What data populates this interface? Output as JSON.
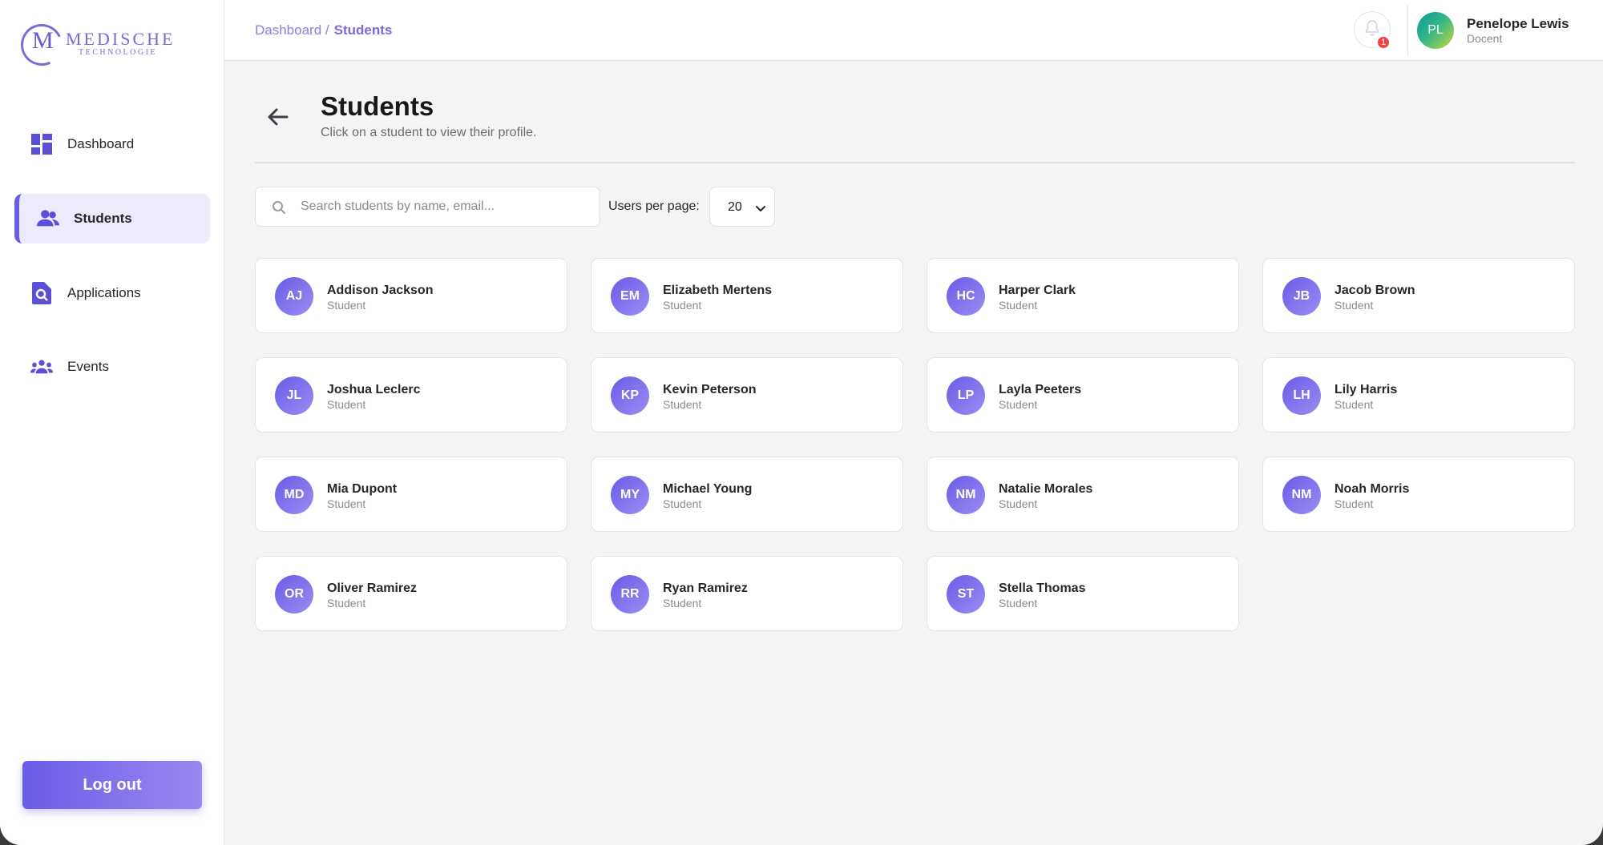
{
  "brand": {
    "mark": "M",
    "name": "MEDISCHE",
    "subtitle": "TECHNOLOGIE",
    "accent_color": "#6b5ce7"
  },
  "sidebar": {
    "items": [
      {
        "label": "Dashboard",
        "icon": "dashboard-icon",
        "active": false
      },
      {
        "label": "Students",
        "icon": "users-icon",
        "active": true
      },
      {
        "label": "Applications",
        "icon": "document-search-icon",
        "active": false
      },
      {
        "label": "Events",
        "icon": "group-icon",
        "active": false
      }
    ],
    "logout_label": "Log out"
  },
  "header": {
    "breadcrumb": {
      "root": "Dashboard /",
      "current": "Students"
    },
    "notifications": {
      "icon": "bell-icon",
      "count": "1"
    },
    "user": {
      "initials": "PL",
      "name": "Penelope Lewis",
      "role": "Docent"
    }
  },
  "main": {
    "title": "Students",
    "subtitle": "Click on a student to view their profile.",
    "search": {
      "placeholder": "Search students by name, email...",
      "value": ""
    },
    "per_page": {
      "label": "Users per page:",
      "value": "20"
    },
    "students": [
      {
        "initials": "AJ",
        "name": "Addison Jackson",
        "role": "Student"
      },
      {
        "initials": "EM",
        "name": "Elizabeth Mertens",
        "role": "Student"
      },
      {
        "initials": "HC",
        "name": "Harper Clark",
        "role": "Student"
      },
      {
        "initials": "JB",
        "name": "Jacob Brown",
        "role": "Student"
      },
      {
        "initials": "JL",
        "name": "Joshua Leclerc",
        "role": "Student"
      },
      {
        "initials": "KP",
        "name": "Kevin Peterson",
        "role": "Student"
      },
      {
        "initials": "LP",
        "name": "Layla Peeters",
        "role": "Student"
      },
      {
        "initials": "LH",
        "name": "Lily Harris",
        "role": "Student"
      },
      {
        "initials": "MD",
        "name": "Mia Dupont",
        "role": "Student"
      },
      {
        "initials": "MY",
        "name": "Michael Young",
        "role": "Student"
      },
      {
        "initials": "NM",
        "name": "Natalie Morales",
        "role": "Student"
      },
      {
        "initials": "NM",
        "name": "Noah Morris",
        "role": "Student"
      },
      {
        "initials": "OR",
        "name": "Oliver Ramirez",
        "role": "Student"
      },
      {
        "initials": "RR",
        "name": "Ryan Ramirez",
        "role": "Student"
      },
      {
        "initials": "ST",
        "name": "Stella Thomas",
        "role": "Student"
      }
    ]
  }
}
